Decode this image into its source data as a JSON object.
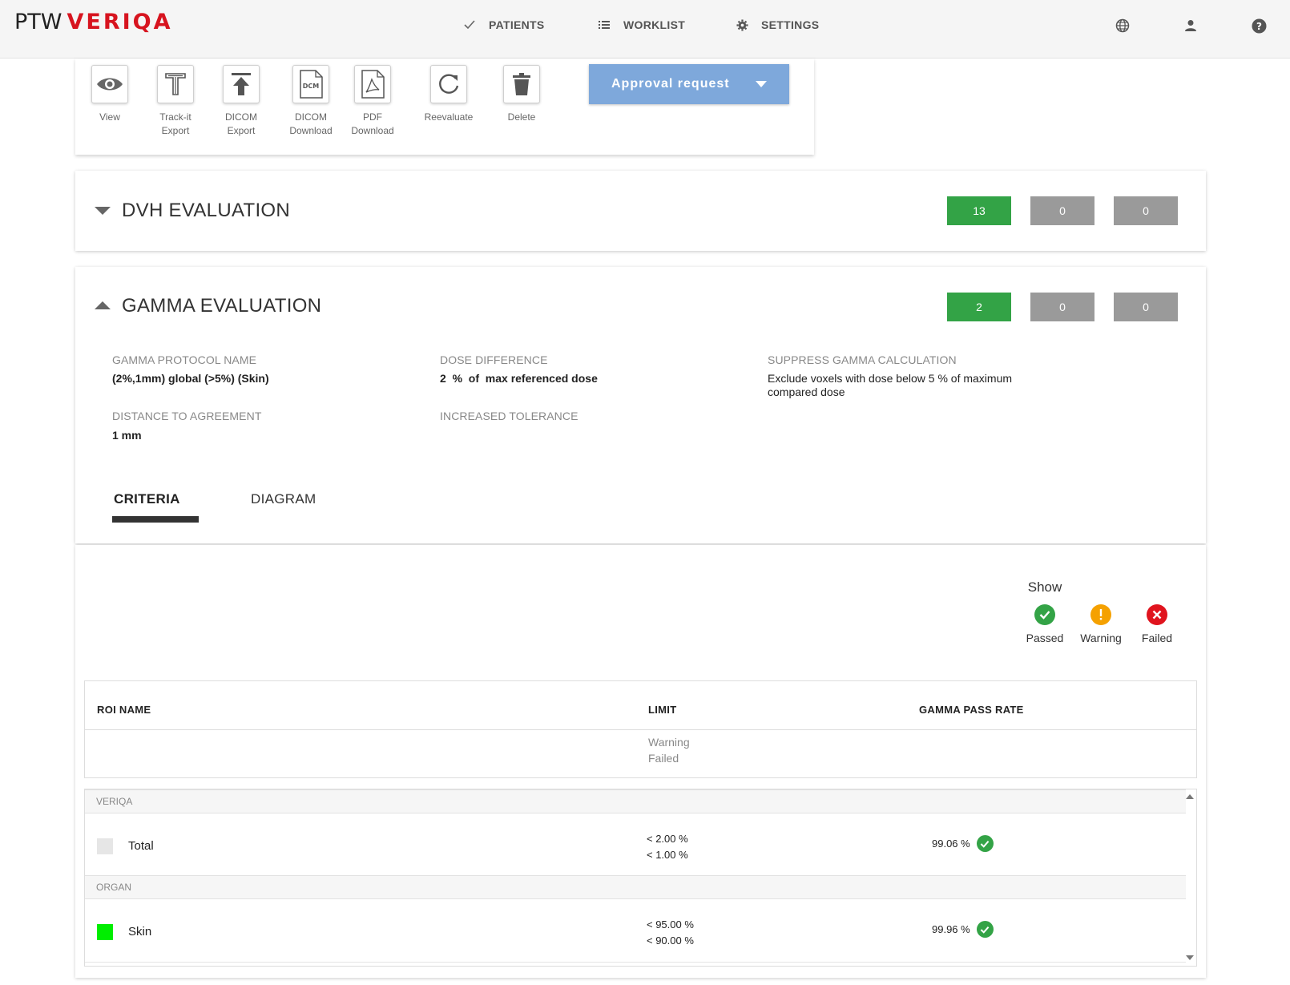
{
  "app": {
    "logo_left": "PTW",
    "logo_right": "VERIQA"
  },
  "nav": {
    "patients": "PATIENTS",
    "worklist": "WORKLIST",
    "settings": "SETTINGS"
  },
  "toolbar": {
    "view": "View",
    "trackit_1": "Track-it",
    "trackit_2": "Export",
    "dicom_export_1": "DICOM",
    "dicom_export_2": "Export",
    "dicom_download_1": "DICOM",
    "dicom_download_2": "Download",
    "dcm_glyph": "DCM",
    "pdf_download_1": "PDF",
    "pdf_download_2": "Download",
    "reevaluate": "Reevaluate",
    "delete": "Delete",
    "approval": "Approval request"
  },
  "dvh": {
    "title": "DVH EVALUATION",
    "passed": "13",
    "warning": "0",
    "failed": "0"
  },
  "gamma": {
    "title": "GAMMA EVALUATION",
    "passed": "2",
    "warning": "0",
    "failed": "0",
    "protocol_label": "GAMMA PROTOCOL NAME",
    "protocol_value": "(2%,1mm) global (>5%) (Skin)",
    "dose_diff_label": "DOSE DIFFERENCE",
    "dose_diff_value": "2  %  of  max referenced dose",
    "suppress_label": "SUPPRESS GAMMA CALCULATION",
    "suppress_value": "Exclude voxels with dose below 5 % of maximum compared dose",
    "dta_label": "DISTANCE TO AGREEMENT",
    "dta_value": "1 mm",
    "tolerance_label": "INCREASED TOLERANCE",
    "tabs": [
      "CRITERIA",
      "DIAGRAM"
    ]
  },
  "criteria": {
    "show_label": "Show",
    "legend": [
      "Passed",
      "Warning",
      "Failed"
    ],
    "columns": [
      "ROI NAME",
      "LIMIT",
      "GAMMA PASS RATE"
    ],
    "limit_sub": [
      "Warning",
      "Failed"
    ],
    "groups": [
      {
        "name": "VERIQA",
        "rows": [
          {
            "roi": "Total",
            "swatch": "#e6e6e6",
            "warning": "< 2.00 %",
            "failed": "< 1.00 %",
            "rate": "99.06 %"
          }
        ]
      },
      {
        "name": "ORGAN",
        "rows": [
          {
            "roi": "Skin",
            "swatch": "#00ee00",
            "warning": "< 95.00 %",
            "failed": "< 90.00 %",
            "rate": "99.96 %"
          }
        ]
      }
    ]
  },
  "colors": {
    "brand": "#d7141f",
    "passed": "#33a346",
    "warning": "#f5a100",
    "failed": "#e0141e",
    "neutral_badge": "#9a9a9a",
    "approval": "#7ea8db"
  }
}
